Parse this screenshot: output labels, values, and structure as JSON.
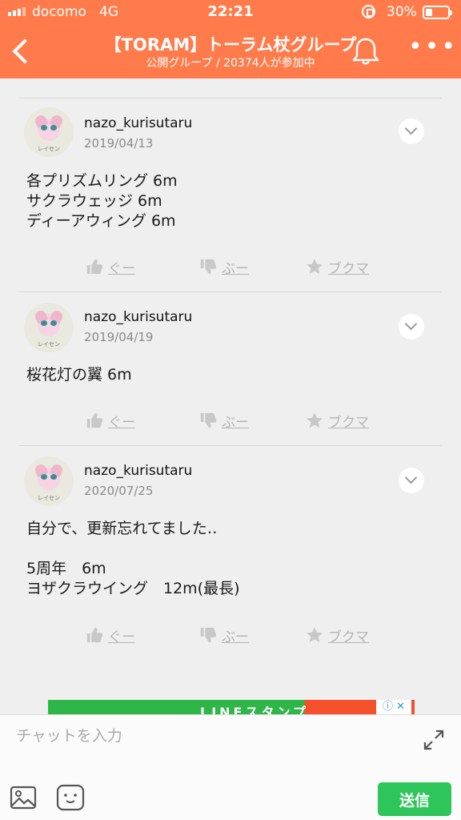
{
  "status_bar": {
    "carrier": "docomo",
    "network": "4G",
    "time": "22:21",
    "battery": "30%"
  },
  "header": {
    "title": "【TORAM】トーラム杖グループ",
    "subtitle": "公開グループ / 20374人が参加中",
    "back_icon": "chevron-left-icon",
    "bell_icon": "bell-icon",
    "more_label": "•••"
  },
  "posts": [
    {
      "user": "nazo_kurisutaru",
      "date": "2019/04/13",
      "avatar_caption": "レイセン",
      "lines": [
        "各プリズムリング 6m",
        "サクラウェッジ 6m",
        "ディーアウィング 6m"
      ]
    },
    {
      "user": "nazo_kurisutaru",
      "date": "2019/04/19",
      "avatar_caption": "レイセン",
      "lines": [
        "桜花灯の翼 6m"
      ]
    },
    {
      "user": "nazo_kurisutaru",
      "date": "2020/07/25",
      "avatar_caption": "レイセン",
      "lines": [
        "自分で、更新忘れてました‥",
        "",
        "5周年　6m",
        "ヨザクラウイング　12m(最長)"
      ]
    }
  ],
  "actions": {
    "good": "ぐー",
    "bad": "ぶー",
    "bookmark": "ブクマ"
  },
  "ad": {
    "text": "LINEスタンプ",
    "close": "ⓘ ✕"
  },
  "composer": {
    "placeholder": "チャットを入力",
    "send_label": "送信"
  },
  "colors": {
    "header": "#ff7b4b",
    "send": "#2ec55a"
  }
}
